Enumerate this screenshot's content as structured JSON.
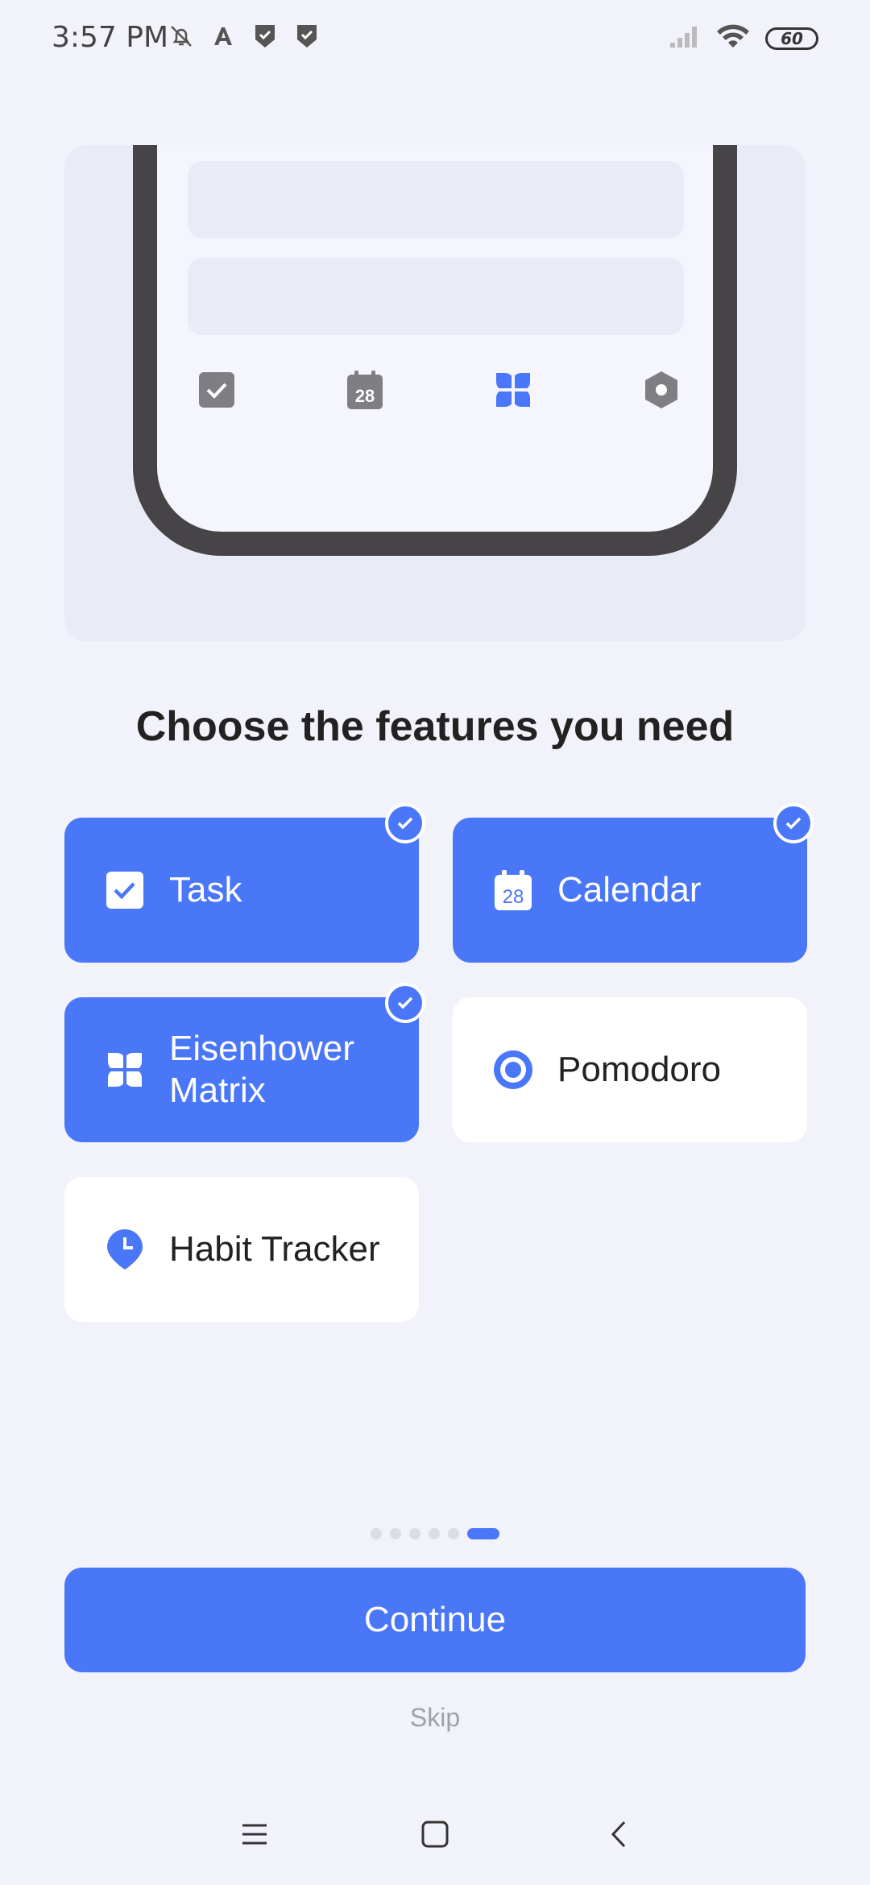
{
  "status_bar": {
    "time": "3:57 PM",
    "battery": "60",
    "icons_left": [
      "mute-icon",
      "a-app-icon",
      "shield-check-icon",
      "shield-check-icon"
    ],
    "icons_right": [
      "signal-icon",
      "wifi-icon",
      "battery-icon"
    ]
  },
  "illustration": {
    "tabs": [
      {
        "name": "task-tab-icon",
        "text": ""
      },
      {
        "name": "calendar-tab-icon",
        "text": "28"
      },
      {
        "name": "matrix-tab-icon",
        "text": ""
      },
      {
        "name": "settings-tab-icon",
        "text": ""
      }
    ]
  },
  "headline": "Choose the features you need",
  "features": [
    {
      "label": "Task",
      "icon": "checkbox-icon",
      "selected": true
    },
    {
      "label": "Calendar",
      "icon": "calendar-icon",
      "calendar_day": "28",
      "selected": true
    },
    {
      "label": "Eisenhower Matrix",
      "icon": "four-petal-icon",
      "selected": true
    },
    {
      "label": "Pomodoro",
      "icon": "target-circle-icon",
      "selected": false
    },
    {
      "label": "Habit Tracker",
      "icon": "clock-pin-icon",
      "selected": false
    }
  ],
  "pager": {
    "total": 6,
    "active_index": 5
  },
  "continue_label": "Continue",
  "skip_label": "Skip",
  "colors": {
    "accent": "#4a76f8",
    "background": "#f2f3fa",
    "card_unselected": "#ffffff"
  }
}
